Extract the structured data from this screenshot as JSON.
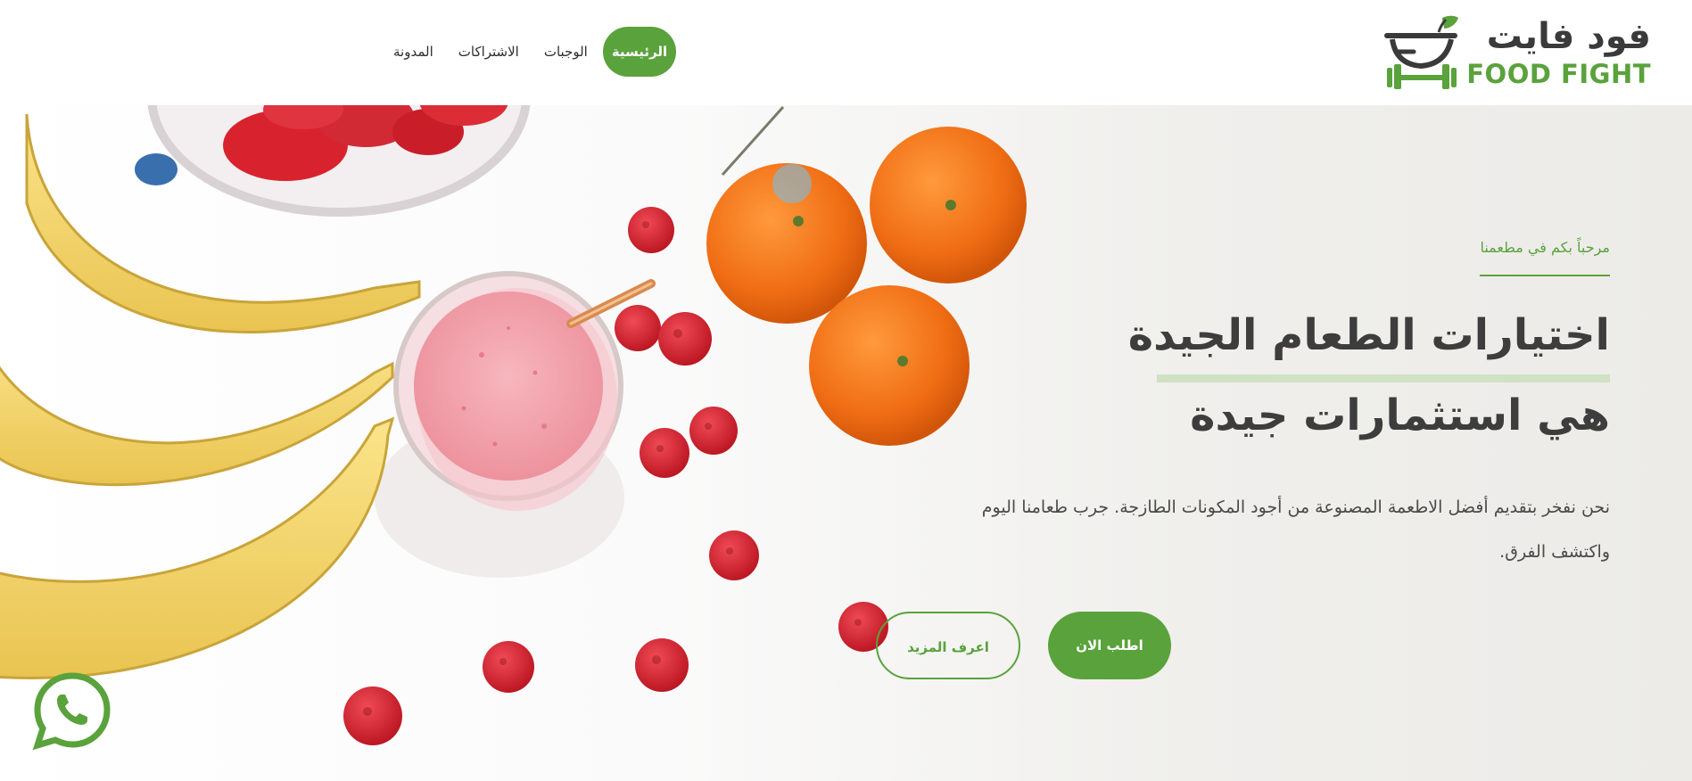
{
  "brand": {
    "name_ar": "فود فايت",
    "name_en": "FOOD FIGHT",
    "accent_color": "#5aa23c",
    "logo_icon": "bowl-dumbbell-leaf-icon"
  },
  "nav": {
    "items": [
      {
        "label": "الرئيسية",
        "active": true
      },
      {
        "label": "الوجبات",
        "active": false
      },
      {
        "label": "الاشتراكات",
        "active": false
      },
      {
        "label": "المدونة",
        "active": false
      }
    ]
  },
  "hero": {
    "welcome": "مرحباً بكم في مطعمنا",
    "title_line1": "اختيارات الطعام الجيدة",
    "title_line2": "هي استثمارات جيدة",
    "description": "نحن نفخر بتقديم أفضل الاطعمة المصنوعة من أجود المكونات الطازجة. جرب طعامنا اليوم واكتشف الفرق.",
    "order_button": "اطلب الان",
    "learn_more_button": "اعرف المزيد",
    "image": "fruits-smoothie-image"
  },
  "floating": {
    "whatsapp_icon": "whatsapp-icon"
  }
}
